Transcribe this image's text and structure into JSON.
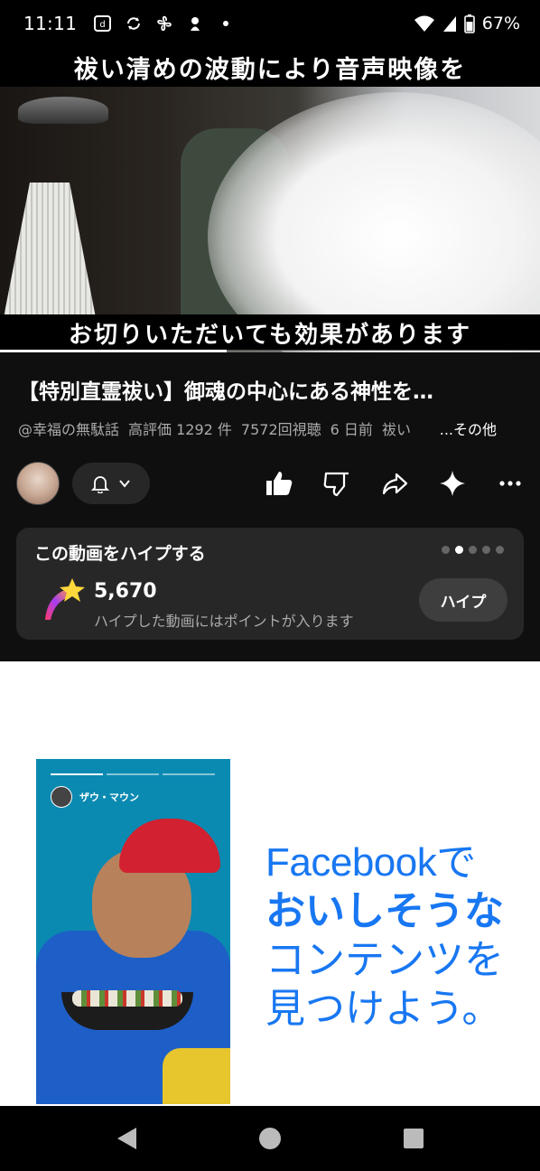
{
  "status_bar": {
    "time": "11:11",
    "battery": "67%",
    "icons": [
      "notification-d-icon",
      "sync-icon",
      "fan-icon",
      "ninja-icon",
      "dot-icon",
      "wifi-icon",
      "signal-icon",
      "battery-icon"
    ]
  },
  "video": {
    "caption_top": "祓い清めの波動により音声映像を",
    "caption_bottom": "お切りいただいても効果があります",
    "progress": 0.42
  },
  "title": "【特別直霊祓い】御魂の中心にある神性を…",
  "meta": {
    "channel": "@幸福の無駄話",
    "likes": "高評価 1292 件",
    "views": "7572回視聴",
    "date": "6 日前",
    "tag": "祓い",
    "more": "...その他"
  },
  "actions": {
    "icons": [
      "like-icon",
      "dislike-icon",
      "share-icon",
      "sparkle-icon",
      "more-icon"
    ]
  },
  "hype": {
    "title": "この動画をハイプする",
    "count": "5,670",
    "subtitle": "ハイプした動画にはポイントが入ります",
    "button": "ハイプ",
    "dots_total": 5,
    "dots_active": 1
  },
  "ad": {
    "user_name": "ザウ・マウン",
    "line1": "Facebookで",
    "line2": "おいしそうな",
    "line3": "コンテンツを",
    "line4": "見つけよう。",
    "accent_color": "#1877f2"
  },
  "navbar": {
    "icons": [
      "back-icon",
      "home-icon",
      "recents-icon"
    ]
  }
}
